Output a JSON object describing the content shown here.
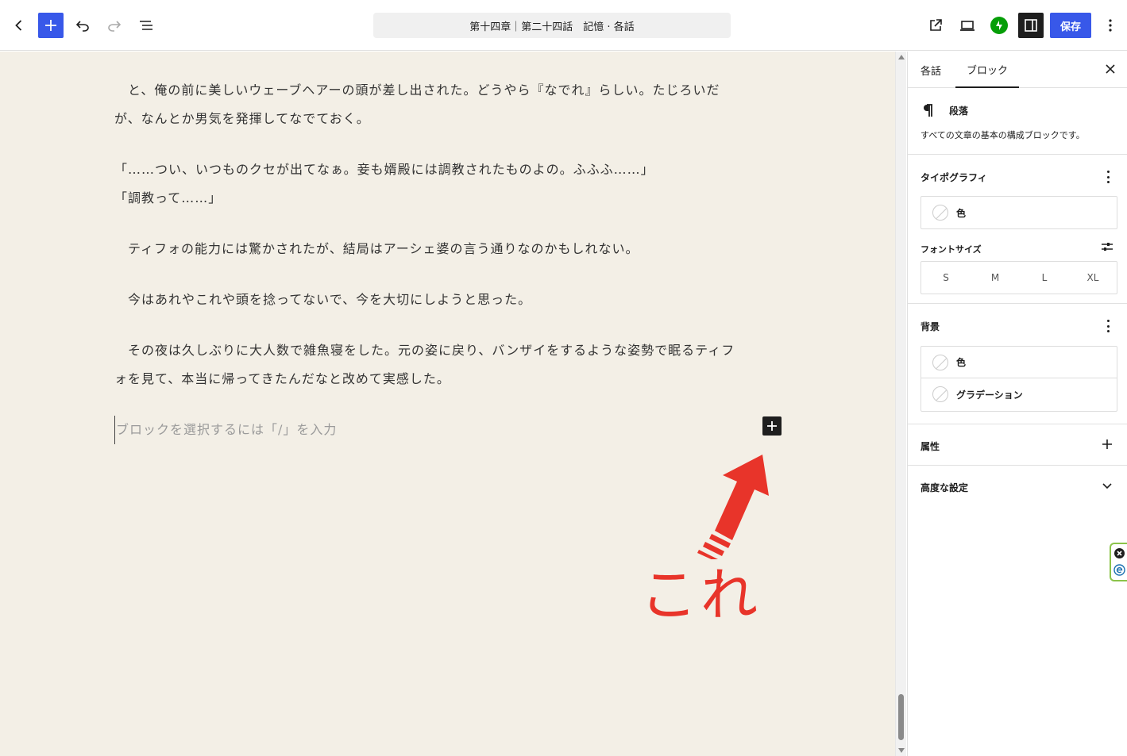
{
  "toolbar": {
    "doc_title": "第十四章｜第二十四話　記憶 · 各話",
    "save_label": "保存"
  },
  "content": {
    "paragraphs": [
      {
        "line1": "　と、俺の前に美しいウェーブヘアーの頭が差し出された。どうやら『なでれ』らしい。たじろいだ",
        "line2": "が、なんとか男気を発揮してなでておく。"
      },
      {
        "line1": "「……つい、いつものクセが出てなぁ。妾も婿殿には調教されたものよの。ふふふ……」",
        "line2": "「調教って……」"
      },
      {
        "line1": "　ティフォの能力には驚かされたが、結局はアーシェ婆の言う通りなのかもしれない。"
      },
      {
        "line1": "　今はあれやこれや頭を捻ってないで、今を大切にしようと思った。"
      },
      {
        "line1": "　その夜は久しぶりに大人数で雑魚寝をした。元の姿に戻り、バンザイをするような姿勢で眠るティフ",
        "line2": "ォを見て、本当に帰ってきたんだなと改めて実感した。"
      }
    ],
    "placeholder": "ブロックを選択するには「/」を入力",
    "annotation": "これ"
  },
  "sidebar": {
    "tabs": [
      "各話",
      "ブロック"
    ],
    "block": {
      "name": "段落",
      "description": "すべての文章の基本の構成ブロックです。"
    },
    "typography": {
      "title": "タイポグラフィ",
      "color_label": "色",
      "font_size_label": "フォントサイズ",
      "sizes": [
        "S",
        "M",
        "L",
        "XL"
      ]
    },
    "background": {
      "title": "背景",
      "color_label": "色",
      "gradient_label": "グラデーション"
    },
    "attributes_title": "属性",
    "advanced_title": "高度な設定"
  },
  "colors": {
    "accent": "#3858e9",
    "canvas_bg": "#f3efe6",
    "annotation": "#e8342a"
  }
}
